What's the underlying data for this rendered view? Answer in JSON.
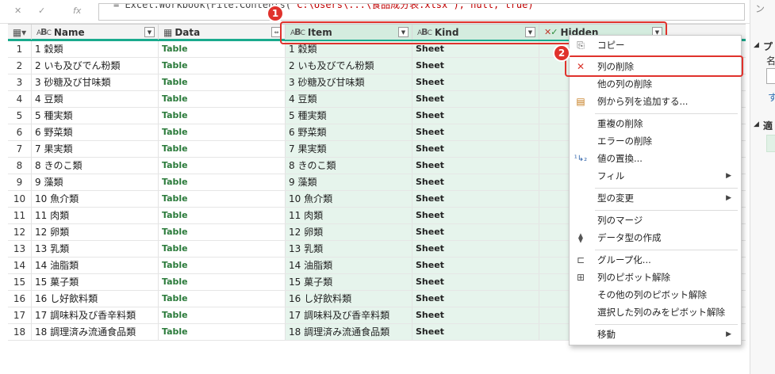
{
  "formula": {
    "text_prefix": "= Excel.Workbook(File.Contents(",
    "text_red": "\"C:\\Users\\...\\食品成分表.xlsx\"), null, true)"
  },
  "columns": [
    {
      "name": "Name",
      "type": "ABC",
      "selected": false
    },
    {
      "name": "Data",
      "type": "table",
      "selected": false
    },
    {
      "name": "Item",
      "type": "ABC",
      "selected": true
    },
    {
      "name": "Kind",
      "type": "ABC",
      "selected": true
    },
    {
      "name": "Hidden",
      "type": "bool",
      "selected": true
    }
  ],
  "rows": [
    {
      "idx": "1",
      "name": "1 穀類",
      "data": "Table",
      "item": "1 穀類",
      "kind": "Sheet"
    },
    {
      "idx": "2",
      "name": "2 いも及びでん粉類",
      "data": "Table",
      "item": "2 いも及びでん粉類",
      "kind": "Sheet"
    },
    {
      "idx": "3",
      "name": "3 砂糖及び甘味類",
      "data": "Table",
      "item": "3 砂糖及び甘味類",
      "kind": "Sheet"
    },
    {
      "idx": "4",
      "name": "4 豆類",
      "data": "Table",
      "item": "4 豆類",
      "kind": "Sheet"
    },
    {
      "idx": "5",
      "name": "5 種実類",
      "data": "Table",
      "item": "5 種実類",
      "kind": "Sheet"
    },
    {
      "idx": "6",
      "name": "6 野菜類",
      "data": "Table",
      "item": "6 野菜類",
      "kind": "Sheet"
    },
    {
      "idx": "7",
      "name": "7 果実類",
      "data": "Table",
      "item": "7 果実類",
      "kind": "Sheet"
    },
    {
      "idx": "8",
      "name": "8 きのこ類",
      "data": "Table",
      "item": "8 きのこ類",
      "kind": "Sheet"
    },
    {
      "idx": "9",
      "name": "9 藻類",
      "data": "Table",
      "item": "9 藻類",
      "kind": "Sheet"
    },
    {
      "idx": "10",
      "name": "10 魚介類",
      "data": "Table",
      "item": "10 魚介類",
      "kind": "Sheet"
    },
    {
      "idx": "11",
      "name": "11 肉類",
      "data": "Table",
      "item": "11 肉類",
      "kind": "Sheet"
    },
    {
      "idx": "12",
      "name": "12 卵類",
      "data": "Table",
      "item": "12 卵類",
      "kind": "Sheet"
    },
    {
      "idx": "13",
      "name": "13 乳類",
      "data": "Table",
      "item": "13 乳類",
      "kind": "Sheet"
    },
    {
      "idx": "14",
      "name": "14 油脂類",
      "data": "Table",
      "item": "14 油脂類",
      "kind": "Sheet"
    },
    {
      "idx": "15",
      "name": "15 菓子類",
      "data": "Table",
      "item": "15 菓子類",
      "kind": "Sheet"
    },
    {
      "idx": "16",
      "name": "16 し好飲料類",
      "data": "Table",
      "item": "16 し好飲料類",
      "kind": "Sheet"
    },
    {
      "idx": "17",
      "name": "17 調味料及び香辛料類",
      "data": "Table",
      "item": "17 調味料及び香辛料類",
      "kind": "Sheet"
    },
    {
      "idx": "18",
      "name": "18  調理済み流通食品類",
      "data": "Table",
      "item": "18  調理済み流通食品類",
      "kind": "Sheet"
    }
  ],
  "badges": {
    "one": "1",
    "two": "2"
  },
  "menu": {
    "copy": "コピー",
    "remove_columns": "列の削除",
    "remove_other_columns": "他の列の削除",
    "add_column_from_examples": "例から列を追加する...",
    "remove_duplicates": "重複の削除",
    "remove_errors": "エラーの削除",
    "replace_values": "値の置換...",
    "fill": "フィル",
    "change_type": "型の変更",
    "merge_columns": "列のマージ",
    "create_data_type": "データ型の作成",
    "group_by": "グループ化...",
    "unpivot_columns": "列のピボット解除",
    "unpivot_other_columns": "その他の列のピボット解除",
    "unpivot_only_selected": "選択した列のみをピボット解除",
    "move": "移動"
  },
  "right_panel": {
    "label_1": "プ",
    "label_2": "名",
    "label_3": "す",
    "label_4": "適"
  },
  "colors": {
    "accent": "#1aaa8d",
    "annotation": "#e0322c",
    "selected": "#d4ecdf"
  }
}
